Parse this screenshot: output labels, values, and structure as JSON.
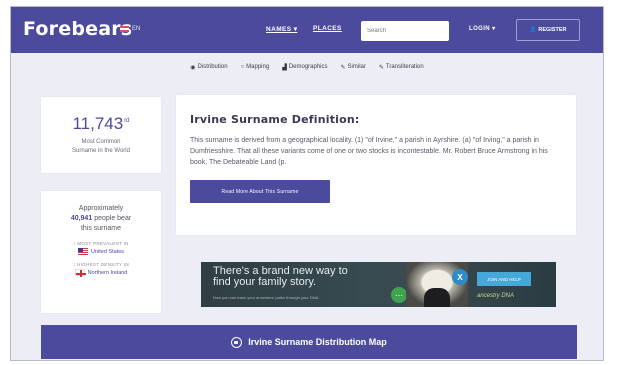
{
  "header": {
    "brand": "Forebears",
    "lang": "EN",
    "nav": [
      "NAMES",
      "PLACES"
    ],
    "search_placeholder": "Search",
    "login": "LOGIN",
    "register": "REGISTER"
  },
  "subnav": [
    {
      "icon": "location-icon",
      "glyph": "◉",
      "label": "Distribution"
    },
    {
      "icon": "globe-icon",
      "glyph": "○",
      "label": "Mapping"
    },
    {
      "icon": "bar-chart-icon",
      "glyph": "▟",
      "label": "Demographics"
    },
    {
      "icon": "pencil-icon",
      "glyph": "✎",
      "label": "Similar"
    },
    {
      "icon": "translate-icon",
      "glyph": "✎",
      "label": "Transliteration"
    }
  ],
  "rank": {
    "value": "11,743",
    "suffix": "rd",
    "line1": "Most Common",
    "line2": "Surname in the World"
  },
  "bearers": {
    "prefix": "Approximately",
    "count": "40,941",
    "suffix_text": "people bear",
    "line3": "this surname",
    "prevalent_label": "MOST PREVALENT IN",
    "prevalent_value": "United States",
    "density_label": "HIGHEST DENSITY IN",
    "density_value": "Northern Ireland"
  },
  "definition": {
    "title": "Irvine Surname Definition:",
    "text": "This surname is derived from a geographical locality. (1) \"of Irvine,\" a parish in Ayrshire. (a) \"of Irving,\" a parish in Dumfriesshire. That all these variants come of one or two stocks is incontestable. Mr. Robert Bruce Armstrong in his book, The Debateable Land (p.",
    "button": "Read More About This Surname"
  },
  "ad": {
    "line1": "There's a brand new way to",
    "line2": "find your family story.",
    "small": "Now you can trace your ancestors' paths through your DNA.",
    "button": "JOIN AND HELP",
    "logo": "ancestry DNA",
    "x_label": "X"
  },
  "map_banner": {
    "label": "Irvine Surname Distribution Map"
  },
  "colors": {
    "brand": "#4b4a9c",
    "page_bg": "#ecedf5"
  }
}
